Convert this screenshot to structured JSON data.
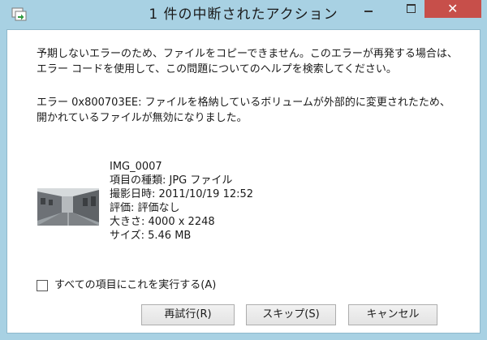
{
  "window": {
    "title": "1 件の中断されたアクション",
    "close_glyph": "✕"
  },
  "message": {
    "line1": "予期しないエラーのため、ファイルをコピーできません。このエラーが再発する場合は、エラー コードを使用して、この問題についてのヘルプを検索してください。",
    "line2": "エラー 0x800703EE: ファイルを格納しているボリュームが外部的に変更されたため、開かれているファイルが無効になりました。"
  },
  "file": {
    "name": "IMG_0007",
    "type": "項目の種類: JPG ファイル",
    "date_taken": "撮影日時: 2011/10/19 12:52",
    "rating": "評価: 評価なし",
    "dimensions": "大きさ: 4000 x 2248",
    "size": "サイズ: 5.46 MB"
  },
  "checkbox": {
    "label": "すべての項目にこれを実行する(A)",
    "checked": false
  },
  "buttons": {
    "retry": "再試行(R)",
    "skip": "スキップ(S)",
    "cancel": "キャンセル"
  },
  "colors": {
    "frame": "#a8d1e3",
    "close_button": "#c74f4a"
  }
}
